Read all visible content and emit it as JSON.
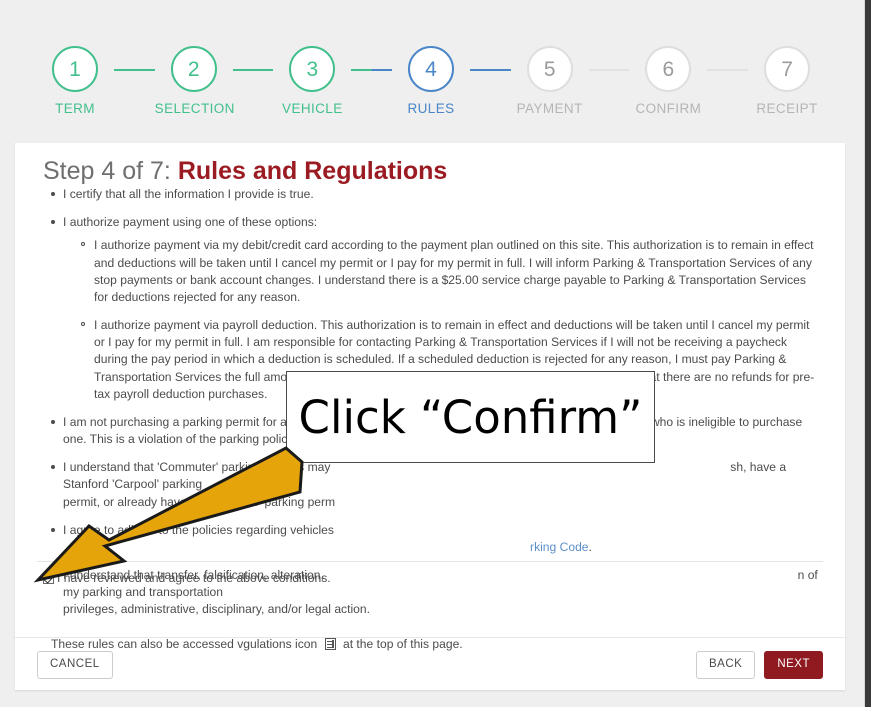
{
  "colors": {
    "page_background": "#efefef",
    "step_done": "#42c08c",
    "step_active": "#4a86c8",
    "step_inactive": "#b5b5b5",
    "title_accent": "#9b1b22",
    "primary_button": "#8f1a1f",
    "link": "#5b8fc9",
    "annotation_arrow": "#e5a50a"
  },
  "stepper": {
    "steps": [
      {
        "number": "1",
        "label": "TERM",
        "state": "done"
      },
      {
        "number": "2",
        "label": "SELECTION",
        "state": "done"
      },
      {
        "number": "3",
        "label": "VEHICLE",
        "state": "done"
      },
      {
        "number": "4",
        "label": "RULES",
        "state": "active"
      },
      {
        "number": "5",
        "label": "PAYMENT",
        "state": "inactive"
      },
      {
        "number": "6",
        "label": "CONFIRM",
        "state": "inactive"
      },
      {
        "number": "7",
        "label": "RECEIPT",
        "state": "inactive"
      }
    ]
  },
  "card": {
    "title_prefix": "Step 4 of 7: ",
    "title_accent": "Rules and Regulations",
    "rules": {
      "certify": "I certify that all the information I provide is true.",
      "authorize_intro": "I authorize payment using one of these options:",
      "authorize_card": "I authorize payment via my debit/credit card according to the payment plan outlined on this site. This authorization is to remain in effect and deductions will be taken until I cancel my permit or I pay for my permit in full. I will inform Parking & Transportation Services of any stop payments or bank account changes. I understand there is a $25.00 service charge payable to Parking & Transportation Services for deductions rejected for any reason.",
      "authorize_payroll": "I authorize payment via payroll deduction. This authorization is to remain in effect and deductions will be taken until I cancel my permit or I pay for my permit in full. I am responsible for contacting Parking & Transportation Services if I will not be receiving a paycheck during the pay period in which a deduction is scheduled. If a scheduled deduction is rejected for any reason, I must pay Parking & Transportation Services the full amount of the deduction immediately upon their request. I understand that there are no refunds for pre-tax payroll deduction purchases.",
      "freshman": "I am not purchasing a parking permit for a vehicle that is registered to a freshman, their family, or for a person who is ineligible to purchase one. This is a violation of the parking policy.",
      "commuter_visible_start": "I understand that 'Commuter' parking permits may",
      "commuter_visible_mid": "permit, or already have a 'Commuter' parking perm",
      "commuter_visible_end": "sh, have a Stanford 'Carpool' parking",
      "policies_start": "I agree to adhere to the policies regarding vehicles",
      "policies_link_end": "rking Code",
      "policies_period": ".",
      "transfer_start": "I understand that transfer, falsification, alteration,",
      "transfer_end": "n of my parking and transportation",
      "transfer_line2": "privileges, administrative, disciplinary, and/or legal action."
    },
    "access_note_start": "These rules can also be accessed v",
    "access_note_mid": "gulations icon",
    "access_note_end": "at the top of this page.",
    "doc_icon_name": "rules-and-regulations-icon",
    "agree_label": "I have reviewed and agree to the above conditions.",
    "agree_checked": true
  },
  "footer": {
    "cancel_label": "CANCEL",
    "back_label": "BACK",
    "next_label": "NEXT"
  },
  "annotation": {
    "callout_text": "Click “Confirm”",
    "arrow_name": "instruction-arrow",
    "arrow_color": "#e5a50a"
  }
}
